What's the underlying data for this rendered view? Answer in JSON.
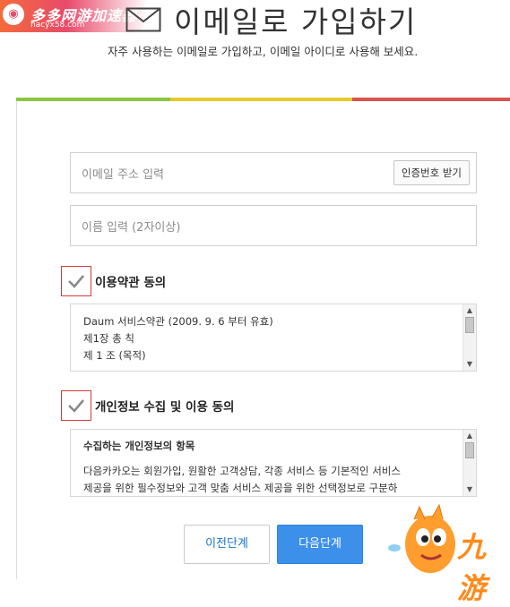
{
  "watermark_top_left": {
    "title": "多多网游加速器",
    "sub": "hacyx58.com"
  },
  "header": {
    "title": "이메일로 가입하기",
    "subtitle": "자주 사용하는 이메일로 가입하고, 이메일 아이디로 사용해 보세요."
  },
  "form": {
    "email_placeholder": "이메일 주소 입력",
    "auth_button": "인증번호 받기",
    "name_placeholder": "이름 입력 (2자이상)"
  },
  "terms": {
    "label": "이용약관 동의",
    "checked": true,
    "lines": [
      "Daum 서비스약관 (2009. 9. 6 부터 유효)",
      "제1장 총 칙",
      "제 1 조 (목적)"
    ]
  },
  "privacy": {
    "label": "개인정보 수집 및 이용 동의",
    "checked": true,
    "lines": [
      "수집하는 개인정보의 항목",
      "다음카카오는 회원가입, 원활한 고객상담, 각종 서비스 등 기본적인 서비스",
      "제공을 위한 필수정보와 고객 맞춤 서비스 제공을 위한 선택정보로 구분하"
    ]
  },
  "buttons": {
    "prev": "이전단계",
    "next": "다음단계"
  },
  "watermark_bottom_right": {
    "text": "九游"
  },
  "colors": {
    "bar_green": "#8cc63f",
    "bar_yellow": "#e8c92a",
    "bar_red": "#d9534f",
    "accent_blue": "#3c90ea",
    "check_border": "#d83a3a"
  }
}
